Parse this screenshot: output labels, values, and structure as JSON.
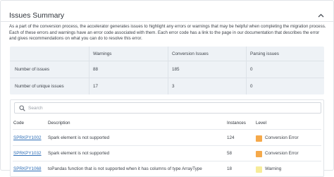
{
  "panel": {
    "title": "Issues Summary",
    "collapse_icon": "chevron-up-icon",
    "intro": "As a part of the conversion process, the accelerator generates issues to highlight any errors or warnings that may be helpful when completing the migration process. Each of these errors and warnings have an error code associated with them. Each error code has a link to the page in our documentation that describes the error and gives recommendations on what you can do to resolve this error."
  },
  "summary": {
    "columns": [
      "",
      "Warnings",
      "Conversion Issues",
      "Parsing issues"
    ],
    "rows": [
      [
        "Number of issues",
        "88",
        "185",
        "0"
      ],
      [
        "Number of unique issues",
        "17",
        "3",
        "0"
      ]
    ]
  },
  "issues": {
    "search": {
      "placeholder": "Search",
      "value": "",
      "icon": "search-icon"
    },
    "columns": {
      "code": "Code",
      "description": "Description",
      "instances": "Instances",
      "level": "Level"
    },
    "rows": [
      {
        "code": "SPRKPY1002",
        "description": "Spark element is not supported",
        "instances": "124",
        "level": "Conversion Error",
        "level_color": "#f5a94a"
      },
      {
        "code": "SPRKPY1032",
        "description": "Spark element is not supported",
        "instances": "58",
        "level": "Conversion Error",
        "level_color": "#f5a94a"
      },
      {
        "code": "SPRKPY1068",
        "description": "toPandas function that is not supported when it has columns of type ArrayType",
        "instances": "18",
        "level": "Warning",
        "level_color": "#f7ec9a"
      }
    ]
  },
  "colors": {
    "link": "#2f6fb7",
    "summary_bg": "#eef2f6",
    "conversion_error": "#f5a94a",
    "warning": "#f7ec9a"
  }
}
